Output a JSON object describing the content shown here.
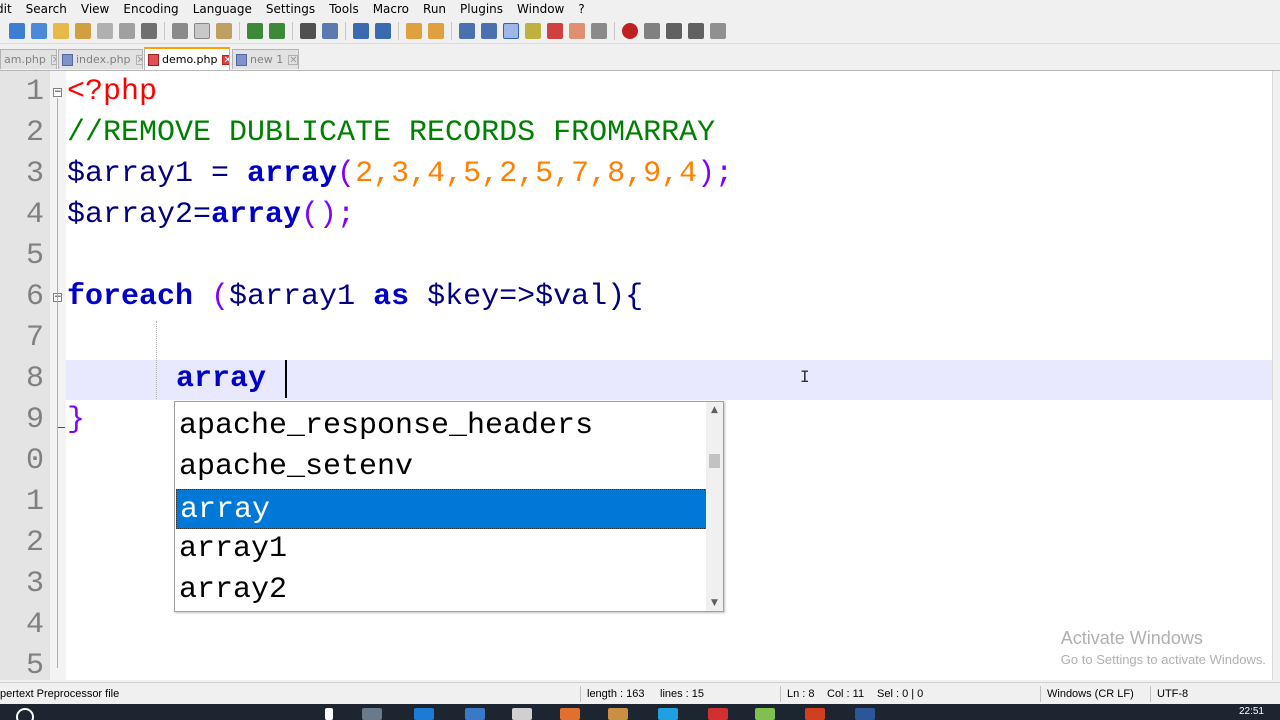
{
  "menu": [
    "dit",
    "Search",
    "View",
    "Encoding",
    "Language",
    "Settings",
    "Tools",
    "Macro",
    "Run",
    "Plugins",
    "Window",
    "?"
  ],
  "tabs": [
    {
      "label": "am.php",
      "active": false
    },
    {
      "label": "index.php",
      "active": false
    },
    {
      "label": "demo.php",
      "active": true
    },
    {
      "label": "new 1",
      "active": false
    }
  ],
  "editor": {
    "line_numbers": [
      "1",
      "2",
      "3",
      "4",
      "5",
      "6",
      "7",
      "8",
      "9",
      "0",
      "1",
      "2",
      "3",
      "4",
      "5"
    ],
    "lines": {
      "l1": "<?php",
      "l2": "//REMOVE DUBLICATE RECORDS FROMARRAY",
      "l3_var": "$array1 = ",
      "l3_fn": "array",
      "l3_open": "(",
      "l3_nums": "2,3,4,5,2,5,7,8,9,4",
      "l3_close": ");",
      "l4_var": "$array2=",
      "l4_fn": "array",
      "l4_rest": "();",
      "l6_kw": "foreach",
      "l6_open": " (",
      "l6_var1": "$array1 ",
      "l6_as": "as",
      "l6_rest": " $key=>$val){",
      "l8_typed": "array",
      "l9": "}"
    }
  },
  "autocomplete": {
    "items": [
      "apache_response_headers",
      "apache_setenv",
      "array",
      "array1",
      "array2"
    ],
    "selected": "array"
  },
  "status": {
    "file_type": "pertext Preprocessor file",
    "length": "length : 163",
    "lines": "lines : 15",
    "ln": "Ln : 8",
    "col": "Col : 11",
    "sel": "Sel : 0 | 0",
    "eol": "Windows (CR LF)",
    "encoding": "UTF-8"
  },
  "watermark": {
    "title": "Activate Windows",
    "subtitle": "Go to Settings to activate Windows."
  },
  "taskbar": {
    "time": "22:51"
  }
}
